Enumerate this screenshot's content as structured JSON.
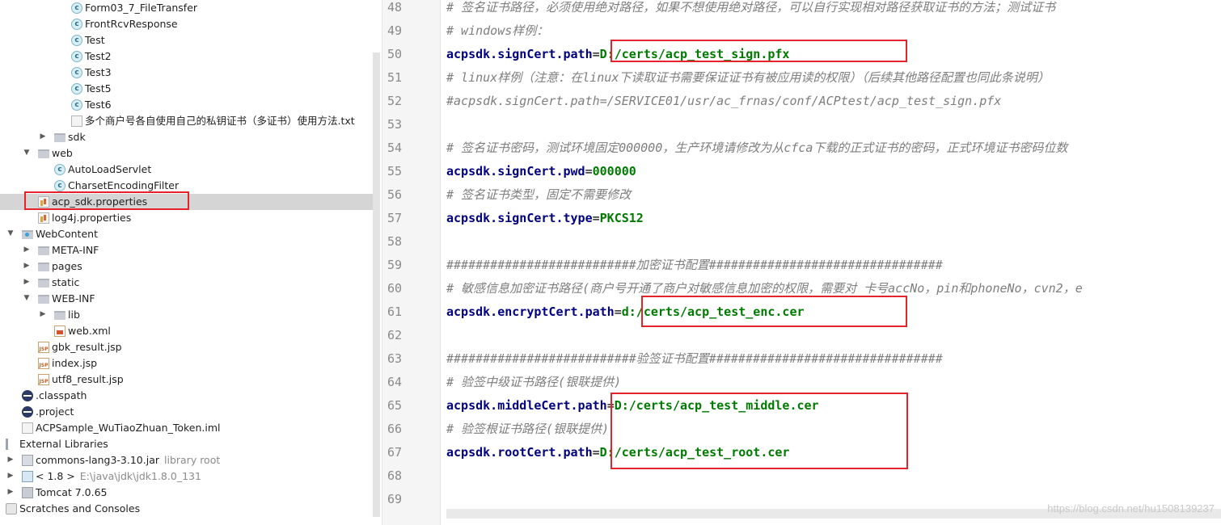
{
  "project_tree": {
    "items": [
      {
        "label": "Form03_7_FileTransfer",
        "icon": "java-class-icon"
      },
      {
        "label": "FrontRcvResponse",
        "icon": "java-class-icon"
      },
      {
        "label": "Test",
        "icon": "java-class-icon"
      },
      {
        "label": "Test2",
        "icon": "java-class-icon"
      },
      {
        "label": "Test3",
        "icon": "java-class-icon"
      },
      {
        "label": "Test5",
        "icon": "java-class-icon"
      },
      {
        "label": "Test6",
        "icon": "java-class-icon"
      },
      {
        "label": "多个商户号各自使用自己的私钥证书（多证书）使用方法.txt",
        "icon": "text-file-icon"
      },
      {
        "label": "sdk",
        "icon": "package-folder-icon"
      },
      {
        "label": "web",
        "icon": "package-folder-icon"
      },
      {
        "label": "AutoLoadServlet",
        "icon": "java-class-icon"
      },
      {
        "label": "CharsetEncodingFilter",
        "icon": "java-class-icon"
      },
      {
        "label": "acp_sdk.properties",
        "icon": "properties-file-icon"
      },
      {
        "label": "log4j.properties",
        "icon": "properties-file-icon"
      },
      {
        "label": "WebContent",
        "icon": "web-folder-icon"
      },
      {
        "label": "META-INF",
        "icon": "folder-icon"
      },
      {
        "label": "pages",
        "icon": "folder-icon"
      },
      {
        "label": "static",
        "icon": "folder-icon"
      },
      {
        "label": "WEB-INF",
        "icon": "folder-icon"
      },
      {
        "label": "lib",
        "icon": "folder-icon"
      },
      {
        "label": "web.xml",
        "icon": "xml-file-icon"
      },
      {
        "label": "gbk_result.jsp",
        "icon": "jsp-file-icon"
      },
      {
        "label": "index.jsp",
        "icon": "jsp-file-icon"
      },
      {
        "label": "utf8_result.jsp",
        "icon": "jsp-file-icon"
      },
      {
        "label": ".classpath",
        "icon": "eclipse-file-icon"
      },
      {
        "label": ".project",
        "icon": "eclipse-file-icon"
      },
      {
        "label": "ACPSample_WuTiaoZhuan_Token.iml",
        "icon": "iml-file-icon"
      },
      {
        "label": "External Libraries",
        "icon": "libraries-icon"
      },
      {
        "label": "commons-lang3-3.10.jar",
        "hint": "library root",
        "icon": "jar-icon"
      },
      {
        "label": "< 1.8 >",
        "hint": "E:\\java\\jdk\\jdk1.8.0_131",
        "icon": "jdk-icon"
      },
      {
        "label": "Tomcat 7.0.65",
        "icon": "tomcat-icon"
      },
      {
        "label": "Scratches and Consoles",
        "icon": "scratches-icon"
      }
    ]
  },
  "editor": {
    "lines": [
      {
        "no": "48",
        "type": "comment",
        "text": "# 签名证书路径，必须使用绝对路径，如果不想使用绝对路径，可以自行实现相对路径获取证书的方法；测试证书"
      },
      {
        "no": "49",
        "type": "comment",
        "text": "# windows样例："
      },
      {
        "no": "50",
        "type": "kv",
        "key": "acpsdk.signCert.path",
        "value": "D:/certs/acp_test_sign.pfx"
      },
      {
        "no": "51",
        "type": "comment",
        "text": "# linux样例（注意：在linux下读取证书需要保证证书有被应用读的权限）（后续其他路径配置也同此条说明）"
      },
      {
        "no": "52",
        "type": "comment",
        "text": "#acpsdk.signCert.path=/SERVICE01/usr/ac_frnas/conf/ACPtest/acp_test_sign.pfx"
      },
      {
        "no": "53",
        "type": "empty",
        "text": ""
      },
      {
        "no": "54",
        "type": "comment",
        "text": "# 签名证书密码，测试环境固定000000，生产环境请修改为从cfca下载的正式证书的密码，正式环境证书密码位数"
      },
      {
        "no": "55",
        "type": "kv",
        "key": "acpsdk.signCert.pwd",
        "value": "000000"
      },
      {
        "no": "56",
        "type": "comment",
        "text": "# 签名证书类型，固定不需要修改"
      },
      {
        "no": "57",
        "type": "kv",
        "key": "acpsdk.signCert.type",
        "value": "PKCS12"
      },
      {
        "no": "58",
        "type": "empty",
        "text": ""
      },
      {
        "no": "59",
        "type": "comment",
        "text": "##########################加密证书配置################################"
      },
      {
        "no": "60",
        "type": "comment",
        "text": "# 敏感信息加密证书路径(商户号开通了商户对敏感信息加密的权限，需要对 卡号accNo，pin和phoneNo，cvn2，e"
      },
      {
        "no": "61",
        "type": "kv",
        "key": "acpsdk.encryptCert.path",
        "value": "d:/certs/acp_test_enc.cer"
      },
      {
        "no": "62",
        "type": "empty",
        "text": ""
      },
      {
        "no": "63",
        "type": "comment",
        "text": "##########################验签证书配置################################"
      },
      {
        "no": "64",
        "type": "comment",
        "text": "# 验签中级证书路径(银联提供)"
      },
      {
        "no": "65",
        "type": "kv",
        "key": "acpsdk.middleCert.path",
        "value": "D:/certs/acp_test_middle.cer"
      },
      {
        "no": "66",
        "type": "comment",
        "text": "# 验签根证书路径(银联提供)"
      },
      {
        "no": "67",
        "type": "kv",
        "key": "acpsdk.rootCert.path",
        "value": "D:/certs/acp_test_root.cer"
      },
      {
        "no": "68",
        "type": "empty",
        "text": ""
      },
      {
        "no": "69",
        "type": "empty",
        "text": ""
      }
    ]
  },
  "watermark": "https://blog.csdn.net/hu1508139237",
  "colors": {
    "annotation": "#e4232a",
    "key": "#000080",
    "value": "#007a00",
    "comment": "#7e7e7e"
  }
}
